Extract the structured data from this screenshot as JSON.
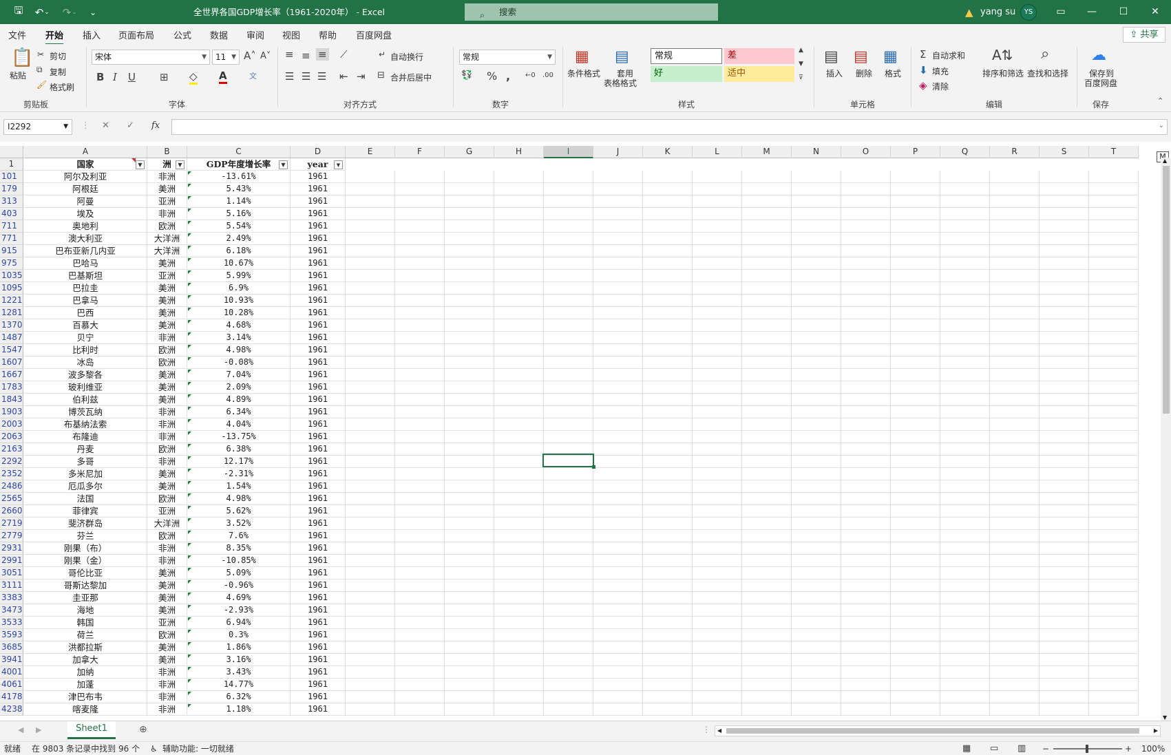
{
  "app": {
    "title": "全世界各国GDP增长率（1961-2020年） - Excel",
    "search": "搜索",
    "user": "yang su",
    "initials": "YS"
  },
  "menu": [
    "文件",
    "开始",
    "插入",
    "页面布局",
    "公式",
    "数据",
    "审阅",
    "视图",
    "帮助",
    "百度网盘"
  ],
  "share": "共享",
  "ribbon": {
    "clipboard": {
      "paste": "粘贴",
      "cut": "剪切",
      "copy": "复制",
      "painter": "格式刷",
      "label": "剪贴板"
    },
    "font": {
      "name": "宋体",
      "size": "11",
      "label": "字体"
    },
    "align": {
      "wrap": "自动换行",
      "merge": "合并后居中",
      "label": "对齐方式"
    },
    "number": {
      "format": "常规",
      "label": "数字"
    },
    "styles": {
      "cond": "条件格式",
      "table1": "套用",
      "table2": "表格格式",
      "normal": "常规",
      "bad": "差",
      "good": "好",
      "neutral": "适中",
      "label": "样式"
    },
    "cells": {
      "insert": "插入",
      "delete": "删除",
      "format": "格式",
      "label": "单元格"
    },
    "edit": {
      "autosum": "自动求和",
      "fill": "填充",
      "clear": "清除",
      "sort": "排序和筛选",
      "find": "查找和选择",
      "label": "编辑"
    },
    "save": {
      "l1": "保存到",
      "l2": "百度网盘",
      "label": "保存"
    }
  },
  "namebox": "I2292",
  "columns": [
    "A",
    "B",
    "C",
    "D",
    "E",
    "F",
    "G",
    "H",
    "I",
    "J",
    "K",
    "L",
    "M",
    "N",
    "O",
    "P",
    "Q",
    "R",
    "S",
    "T"
  ],
  "headers": {
    "a": "国家",
    "b": "洲",
    "c": "GDP年度增长率",
    "d": "year"
  },
  "rows": [
    {
      "n": "101",
      "a": "阿尔及利亚",
      "b": "非洲",
      "c": "-13.61%",
      "d": "1961"
    },
    {
      "n": "179",
      "a": "阿根廷",
      "b": "美洲",
      "c": "5.43%",
      "d": "1961"
    },
    {
      "n": "313",
      "a": "阿曼",
      "b": "亚洲",
      "c": "1.14%",
      "d": "1961"
    },
    {
      "n": "403",
      "a": "埃及",
      "b": "非洲",
      "c": "5.16%",
      "d": "1961"
    },
    {
      "n": "711",
      "a": "奥地利",
      "b": "欧洲",
      "c": "5.54%",
      "d": "1961"
    },
    {
      "n": "771",
      "a": "澳大利亚",
      "b": "大洋洲",
      "c": "2.49%",
      "d": "1961"
    },
    {
      "n": "915",
      "a": "巴布亚新几内亚",
      "b": "大洋洲",
      "c": "6.18%",
      "d": "1961"
    },
    {
      "n": "975",
      "a": "巴哈马",
      "b": "美洲",
      "c": "10.67%",
      "d": "1961"
    },
    {
      "n": "1035",
      "a": "巴基斯坦",
      "b": "亚洲",
      "c": "5.99%",
      "d": "1961"
    },
    {
      "n": "1095",
      "a": "巴拉圭",
      "b": "美洲",
      "c": "6.9%",
      "d": "1961"
    },
    {
      "n": "1221",
      "a": "巴拿马",
      "b": "美洲",
      "c": "10.93%",
      "d": "1961"
    },
    {
      "n": "1281",
      "a": "巴西",
      "b": "美洲",
      "c": "10.28%",
      "d": "1961"
    },
    {
      "n": "1370",
      "a": "百慕大",
      "b": "美洲",
      "c": "4.68%",
      "d": "1961"
    },
    {
      "n": "1487",
      "a": "贝宁",
      "b": "非洲",
      "c": "3.14%",
      "d": "1961"
    },
    {
      "n": "1547",
      "a": "比利时",
      "b": "欧洲",
      "c": "4.98%",
      "d": "1961"
    },
    {
      "n": "1607",
      "a": "冰岛",
      "b": "欧洲",
      "c": "-0.08%",
      "d": "1961"
    },
    {
      "n": "1667",
      "a": "波多黎各",
      "b": "美洲",
      "c": "7.04%",
      "d": "1961"
    },
    {
      "n": "1783",
      "a": "玻利维亚",
      "b": "美洲",
      "c": "2.09%",
      "d": "1961"
    },
    {
      "n": "1843",
      "a": "伯利兹",
      "b": "美洲",
      "c": "4.89%",
      "d": "1961"
    },
    {
      "n": "1903",
      "a": "博茨瓦纳",
      "b": "非洲",
      "c": "6.34%",
      "d": "1961"
    },
    {
      "n": "2003",
      "a": "布基纳法索",
      "b": "非洲",
      "c": "4.04%",
      "d": "1961"
    },
    {
      "n": "2063",
      "a": "布隆迪",
      "b": "非洲",
      "c": "-13.75%",
      "d": "1961"
    },
    {
      "n": "2163",
      "a": "丹麦",
      "b": "欧洲",
      "c": "6.38%",
      "d": "1961"
    },
    {
      "n": "2292",
      "a": "多哥",
      "b": "非洲",
      "c": "12.17%",
      "d": "1961"
    },
    {
      "n": "2352",
      "a": "多米尼加",
      "b": "美洲",
      "c": "-2.31%",
      "d": "1961"
    },
    {
      "n": "2486",
      "a": "厄瓜多尔",
      "b": "美洲",
      "c": "1.54%",
      "d": "1961"
    },
    {
      "n": "2565",
      "a": "法国",
      "b": "欧洲",
      "c": "4.98%",
      "d": "1961"
    },
    {
      "n": "2660",
      "a": "菲律宾",
      "b": "亚洲",
      "c": "5.62%",
      "d": "1961"
    },
    {
      "n": "2719",
      "a": "斐济群岛",
      "b": "大洋洲",
      "c": "3.52%",
      "d": "1961"
    },
    {
      "n": "2779",
      "a": "芬兰",
      "b": "欧洲",
      "c": "7.6%",
      "d": "1961"
    },
    {
      "n": "2931",
      "a": "刚果（布）",
      "b": "非洲",
      "c": "8.35%",
      "d": "1961"
    },
    {
      "n": "2991",
      "a": "刚果（金）",
      "b": "非洲",
      "c": "-10.85%",
      "d": "1961"
    },
    {
      "n": "3051",
      "a": "哥伦比亚",
      "b": "美洲",
      "c": "5.09%",
      "d": "1961"
    },
    {
      "n": "3111",
      "a": "哥斯达黎加",
      "b": "美洲",
      "c": "-0.96%",
      "d": "1961"
    },
    {
      "n": "3383",
      "a": "圭亚那",
      "b": "美洲",
      "c": "4.69%",
      "d": "1961"
    },
    {
      "n": "3473",
      "a": "海地",
      "b": "美洲",
      "c": "-2.93%",
      "d": "1961"
    },
    {
      "n": "3533",
      "a": "韩国",
      "b": "亚洲",
      "c": "6.94%",
      "d": "1961"
    },
    {
      "n": "3593",
      "a": "荷兰",
      "b": "欧洲",
      "c": "0.3%",
      "d": "1961"
    },
    {
      "n": "3685",
      "a": "洪都拉斯",
      "b": "美洲",
      "c": "1.86%",
      "d": "1961"
    },
    {
      "n": "3941",
      "a": "加拿大",
      "b": "美洲",
      "c": "3.16%",
      "d": "1961"
    },
    {
      "n": "4001",
      "a": "加纳",
      "b": "非洲",
      "c": "3.43%",
      "d": "1961"
    },
    {
      "n": "4061",
      "a": "加蓬",
      "b": "非洲",
      "c": "14.77%",
      "d": "1961"
    },
    {
      "n": "4178",
      "a": "津巴布韦",
      "b": "非洲",
      "c": "6.32%",
      "d": "1961"
    },
    {
      "n": "4238",
      "a": "喀麦隆",
      "b": "非洲",
      "c": "1.18%",
      "d": "1961"
    }
  ],
  "sheet": "Sheet1",
  "status": {
    "ready": "就绪",
    "records": "在 9803 条记录中找到 96 个",
    "access": "辅助功能: 一切就绪",
    "zoom": "100%"
  }
}
